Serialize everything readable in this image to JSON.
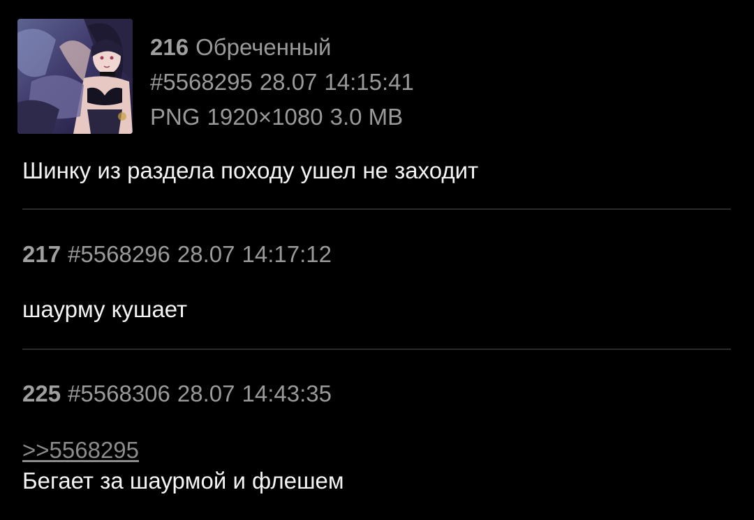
{
  "posts": [
    {
      "number": "216",
      "name": "Обреченный",
      "id": "#5568295",
      "date": "28.07",
      "time": "14:15:41",
      "file": {
        "type": "PNG",
        "resolution": "1920×1080",
        "size": "3.0 MB"
      },
      "text": "Шинку из раздела походу ушел не заходит"
    },
    {
      "number": "217",
      "id": "#5568296",
      "date": "28.07",
      "time": "14:17:12",
      "text": "шаурму кушает"
    },
    {
      "number": "225",
      "id": "#5568306",
      "date": "28.07",
      "time": "14:43:35",
      "reply_to": ">>5568295",
      "text": "Бегает за шаурмой и флешем"
    }
  ],
  "colors": {
    "background": "#000000",
    "meta_text": "#9a9a9a",
    "body_text": "#f4f4f4",
    "link": "#8c8c8c",
    "divider": "#2b2b2b"
  }
}
